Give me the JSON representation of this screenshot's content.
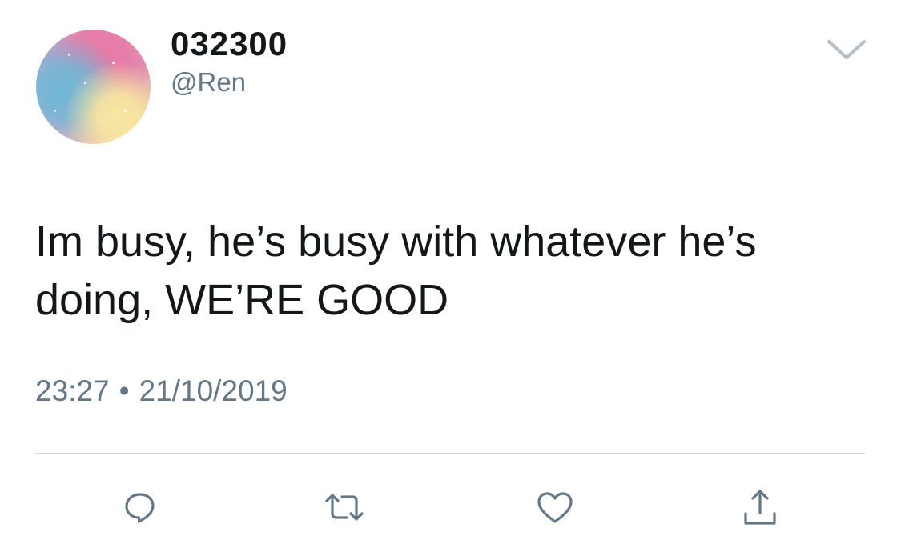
{
  "tweet": {
    "author": {
      "display_name": "032300",
      "handle": "@Ren"
    },
    "text": "Im busy, he’s busy with whatever he’s doing, WE’RE GOOD",
    "time": "23:27",
    "separator": "•",
    "date": "21/10/2019"
  },
  "icons": {
    "menu": "chevron-down-icon",
    "reply": "reply-icon",
    "retweet": "retweet-icon",
    "like": "heart-icon",
    "share": "share-icon"
  },
  "colors": {
    "text_primary": "#14171a",
    "text_secondary": "#657786",
    "icon": "#657786",
    "divider": "#cfd6dc"
  }
}
